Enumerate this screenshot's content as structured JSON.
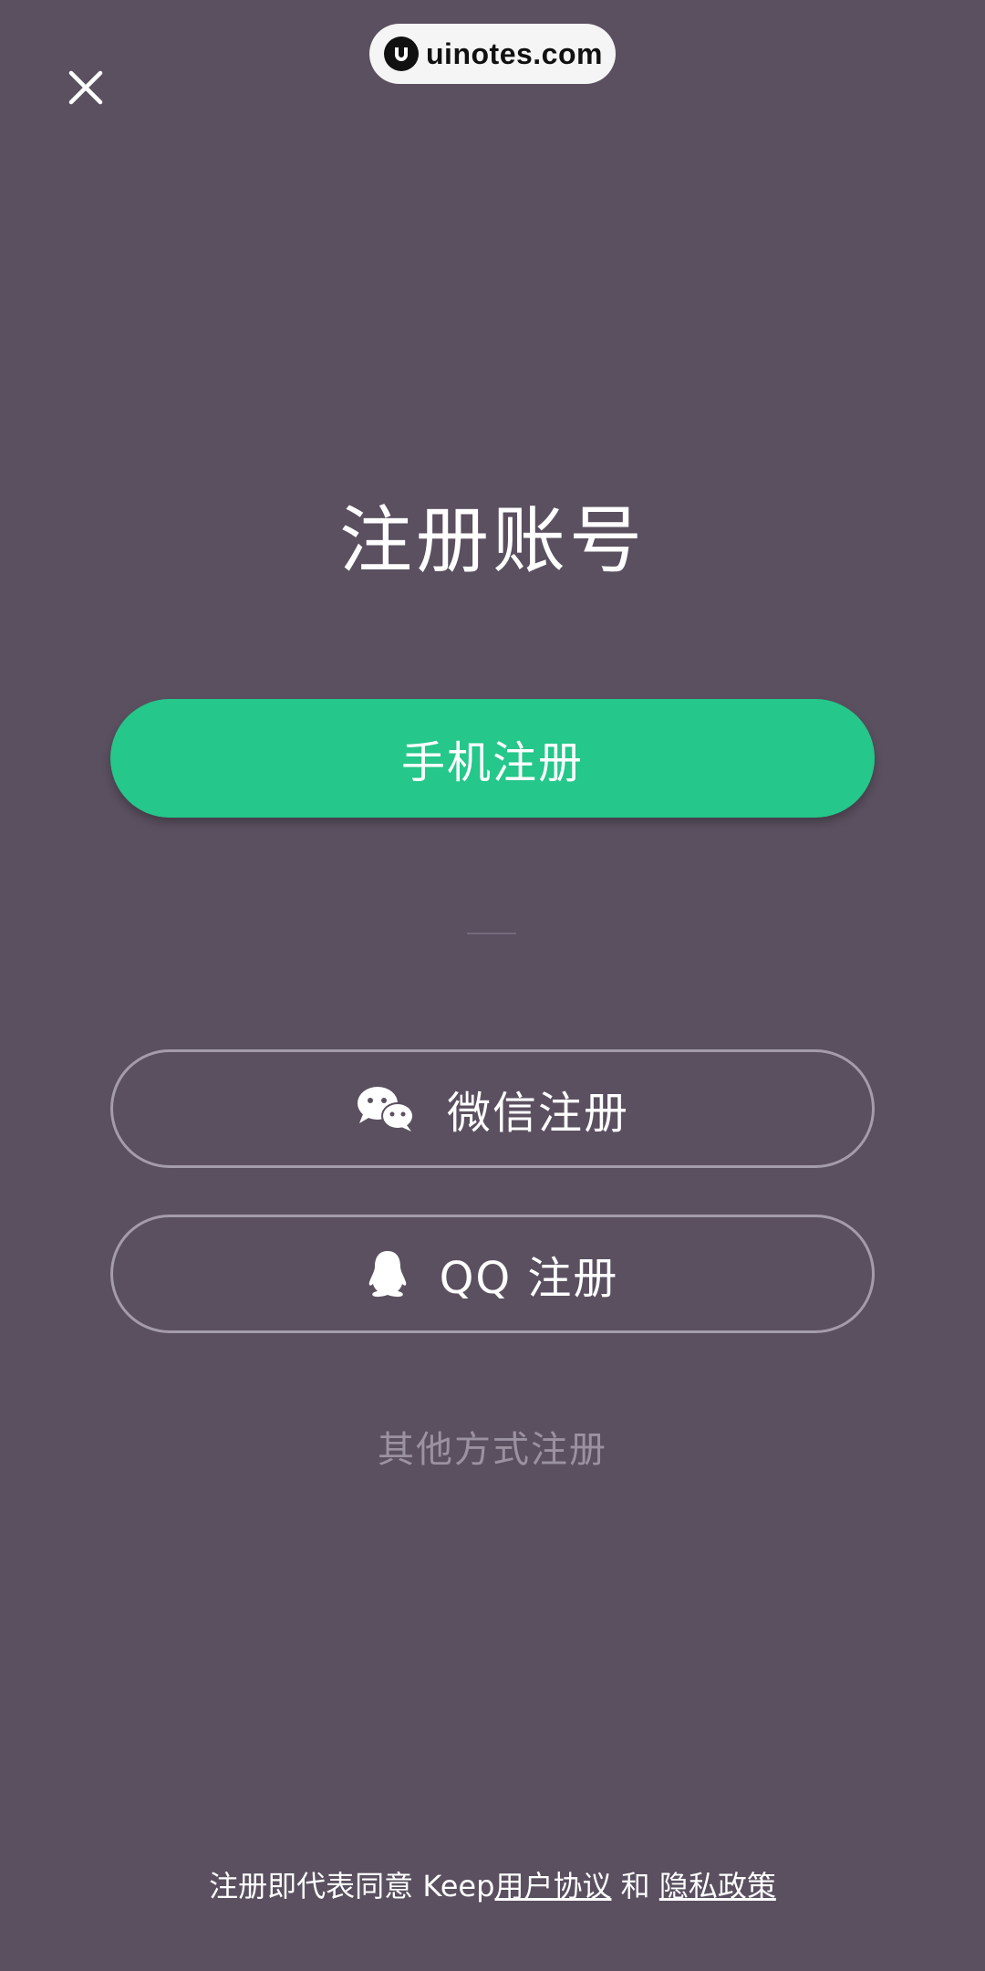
{
  "watermark": {
    "text": "uinotes.com"
  },
  "header": {
    "close_icon": "close-icon"
  },
  "title": "注册账号",
  "phone_register": {
    "label": "手机注册",
    "color": "#25c78a"
  },
  "wechat_register": {
    "label": "微信注册",
    "icon": "wechat-icon"
  },
  "qq_register": {
    "label": "QQ 注册",
    "icon": "qq-penguin-icon"
  },
  "other_register": {
    "label": "其他方式注册"
  },
  "terms": {
    "prefix": "注册即代表同意 Keep",
    "user_agreement": "用户协议",
    "conjunction": " 和 ",
    "privacy_policy": "隐私政策"
  },
  "colors": {
    "background": "#5b5060",
    "accent": "#25c78a",
    "muted_text": "#9b92a1",
    "outline": "#a49cab"
  }
}
